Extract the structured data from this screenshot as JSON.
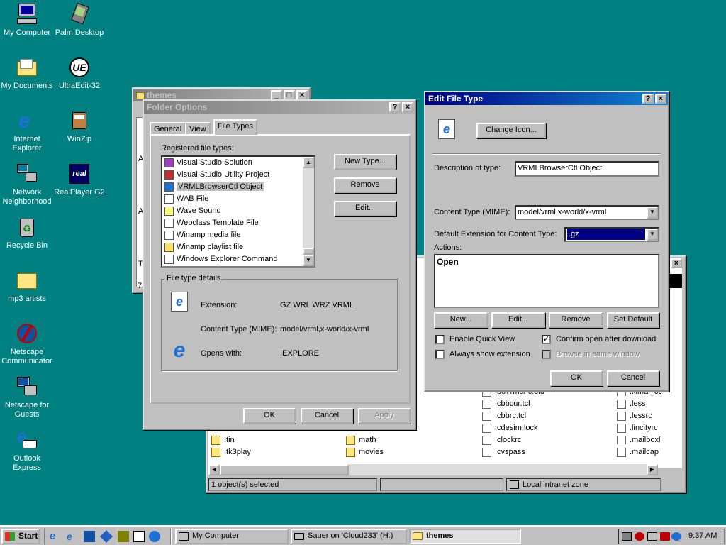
{
  "desktop": {
    "icons": [
      {
        "label": "My Computer",
        "icon": "computer-icon"
      },
      {
        "label": "Palm Desktop",
        "icon": "palm-icon"
      },
      {
        "label": "My Documents",
        "icon": "folder-icon"
      },
      {
        "label": "UltraEdit-32",
        "icon": "ultraedit-icon"
      },
      {
        "label": "Internet Explorer",
        "icon": "ie-icon"
      },
      {
        "label": "WinZip",
        "icon": "winzip-icon"
      },
      {
        "label": "Network Neighborhood",
        "icon": "network-icon"
      },
      {
        "label": "RealPlayer G2",
        "icon": "real-icon"
      },
      {
        "label": "Recycle Bin",
        "icon": "recycle-bin-icon"
      },
      {
        "label": "mp3 artists",
        "icon": "folder-icon"
      },
      {
        "label": "Netscape Communicator",
        "icon": "netscape-icon"
      },
      {
        "label": "Netscape for Guests",
        "icon": "netscape-guests-icon"
      },
      {
        "label": "Outlook Express",
        "icon": "outlook-icon"
      }
    ]
  },
  "themes_window": {
    "title": "themes",
    "status_left": "1 object(s) selected",
    "status_right": "Local intranet zone",
    "left_edge_letters": [
      "A",
      "A",
      "T",
      "7"
    ],
    "files_col1": [
      ".tin",
      ".tk3play"
    ],
    "files_col2": [
      "math",
      "movies"
    ],
    "files_col3": [
      ".boттmaric.old",
      ".cbbcur.tcl",
      ".cbbrc.tcl",
      ".cdesim.lock",
      ".clockrc",
      ".cvspass"
    ],
    "files_col4": [
      ".kimai_cor",
      ".less",
      ".lessrc",
      ".lincityrc",
      ".mailboxlis",
      ".mailcap"
    ]
  },
  "folder_options": {
    "title": "Folder Options",
    "tabs": [
      "General",
      "View",
      "File Types"
    ],
    "registered_label": "Registered file types:",
    "file_types": [
      "Visual Studio Solution",
      "Visual Studio Utility Project",
      "VRMLBrowserCtl Object",
      "WAB File",
      "Wave Sound",
      "Webclass Template File",
      "Winamp media file",
      "Winamp playlist file",
      "Windows Explorer Command"
    ],
    "selected_index": 2,
    "buttons": {
      "new_type": "New Type...",
      "remove": "Remove",
      "edit": "Edit..."
    },
    "details_label": "File type details",
    "extension_label": "Extension:",
    "extension_value": "GZ WRL WRZ VRML",
    "content_type_label": "Content Type (MIME):",
    "content_type_value": "model/vrml,x-world/x-vrml",
    "opens_with_label": "Opens with:",
    "opens_with_value": "IEXPLORE",
    "ok": "OK",
    "cancel": "Cancel",
    "apply": "Apply"
  },
  "edit_file_type": {
    "title": "Edit File Type",
    "change_icon": "Change Icon...",
    "description_label": "Description of type:",
    "description_value": "VRMLBrowserCtl Object",
    "content_type_label": "Content Type (MIME):",
    "content_type_value": "model/vrml,x-world/x-vrml",
    "default_ext_label": "Default Extension for Content Type:",
    "default_ext_value": ".gz",
    "actions_label": "Actions:",
    "actions": [
      "Open"
    ],
    "buttons": {
      "new": "New...",
      "edit": "Edit...",
      "remove": "Remove",
      "set_default": "Set Default"
    },
    "enable_quick_view": "Enable Quick View",
    "always_show_ext": "Always show extension",
    "confirm_open": "Confirm open after download",
    "browse_same_window": "Browse in same window",
    "ok": "OK",
    "cancel": "Cancel"
  },
  "taskbar": {
    "start": "Start",
    "tasks": [
      "My Computer",
      "Sauer on 'Cloud233' (H:)",
      "themes"
    ],
    "active_task": 2,
    "clock": "9:37 AM"
  },
  "colors": {
    "desktop": "#008080",
    "active_title": "#000080",
    "face": "#c0c0c0"
  }
}
